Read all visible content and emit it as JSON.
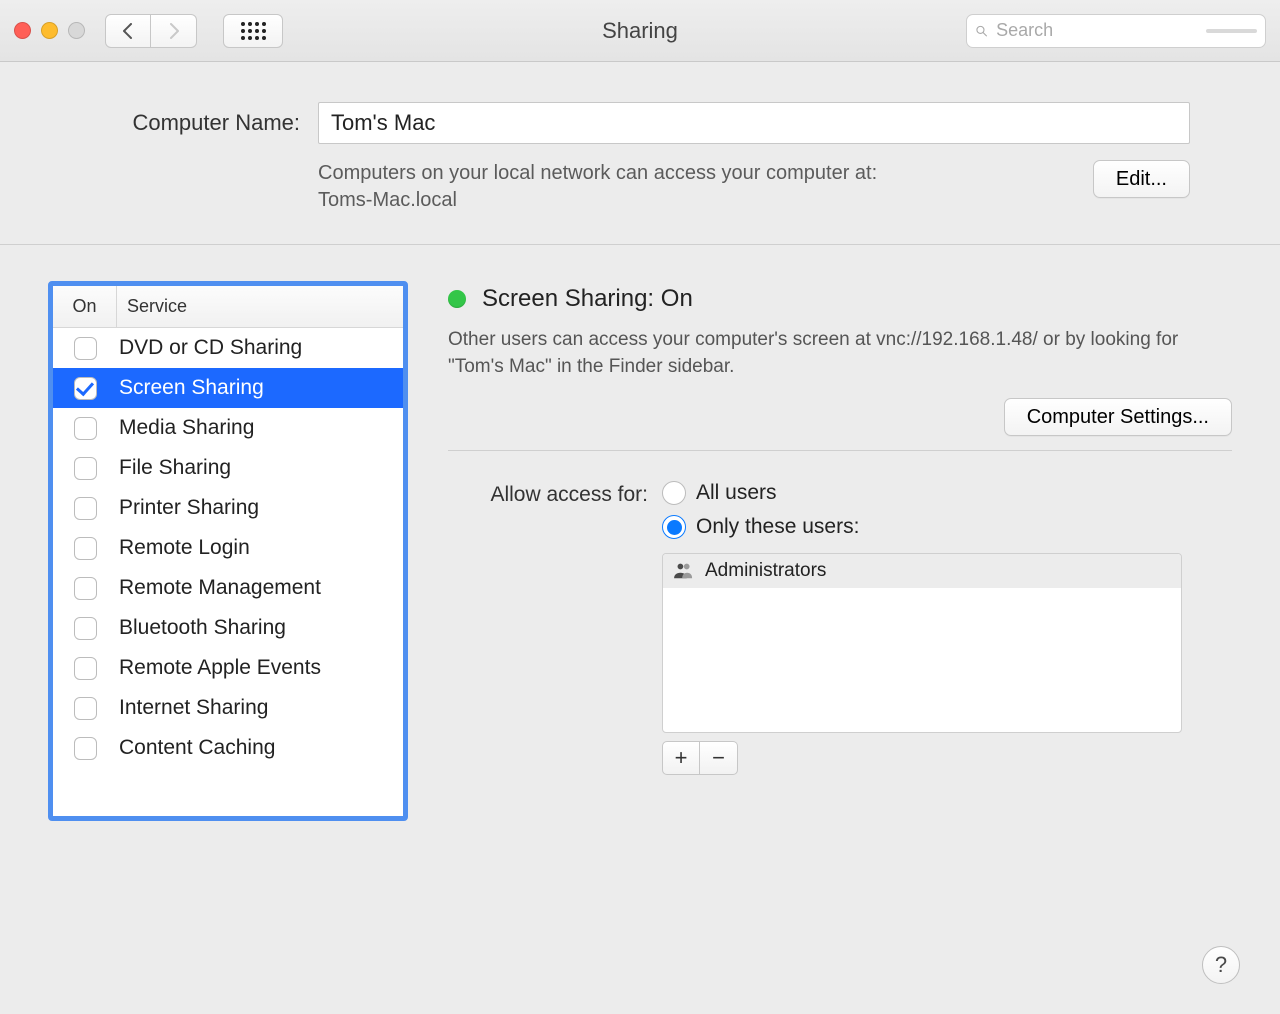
{
  "window": {
    "title": "Sharing"
  },
  "search": {
    "placeholder": "Search"
  },
  "computer_name": {
    "label": "Computer Name:",
    "value": "Tom's Mac",
    "hint_line1": "Computers on your local network can access your computer at:",
    "hint_line2": "Toms-Mac.local",
    "edit_label": "Edit..."
  },
  "services": {
    "header_on": "On",
    "header_service": "Service",
    "items": [
      {
        "label": "DVD or CD Sharing",
        "on": false,
        "selected": false
      },
      {
        "label": "Screen Sharing",
        "on": true,
        "selected": true
      },
      {
        "label": "Media Sharing",
        "on": false,
        "selected": false
      },
      {
        "label": "File Sharing",
        "on": false,
        "selected": false
      },
      {
        "label": "Printer Sharing",
        "on": false,
        "selected": false
      },
      {
        "label": "Remote Login",
        "on": false,
        "selected": false
      },
      {
        "label": "Remote Management",
        "on": false,
        "selected": false
      },
      {
        "label": "Bluetooth Sharing",
        "on": false,
        "selected": false
      },
      {
        "label": "Remote Apple Events",
        "on": false,
        "selected": false
      },
      {
        "label": "Internet Sharing",
        "on": false,
        "selected": false
      },
      {
        "label": "Content Caching",
        "on": false,
        "selected": false
      }
    ]
  },
  "detail": {
    "status_title": "Screen Sharing: On",
    "status_color": "#33c648",
    "status_desc": "Other users can access your computer's screen at vnc://192.168.1.48/ or by looking for \"Tom's Mac\" in the Finder sidebar.",
    "computer_settings_label": "Computer Settings...",
    "access_label": "Allow access for:",
    "radio_all": "All users",
    "radio_only": "Only these users:",
    "radio_selected": "only",
    "users": [
      {
        "label": "Administrators"
      }
    ],
    "plus": "+",
    "minus": "−"
  },
  "help": "?"
}
